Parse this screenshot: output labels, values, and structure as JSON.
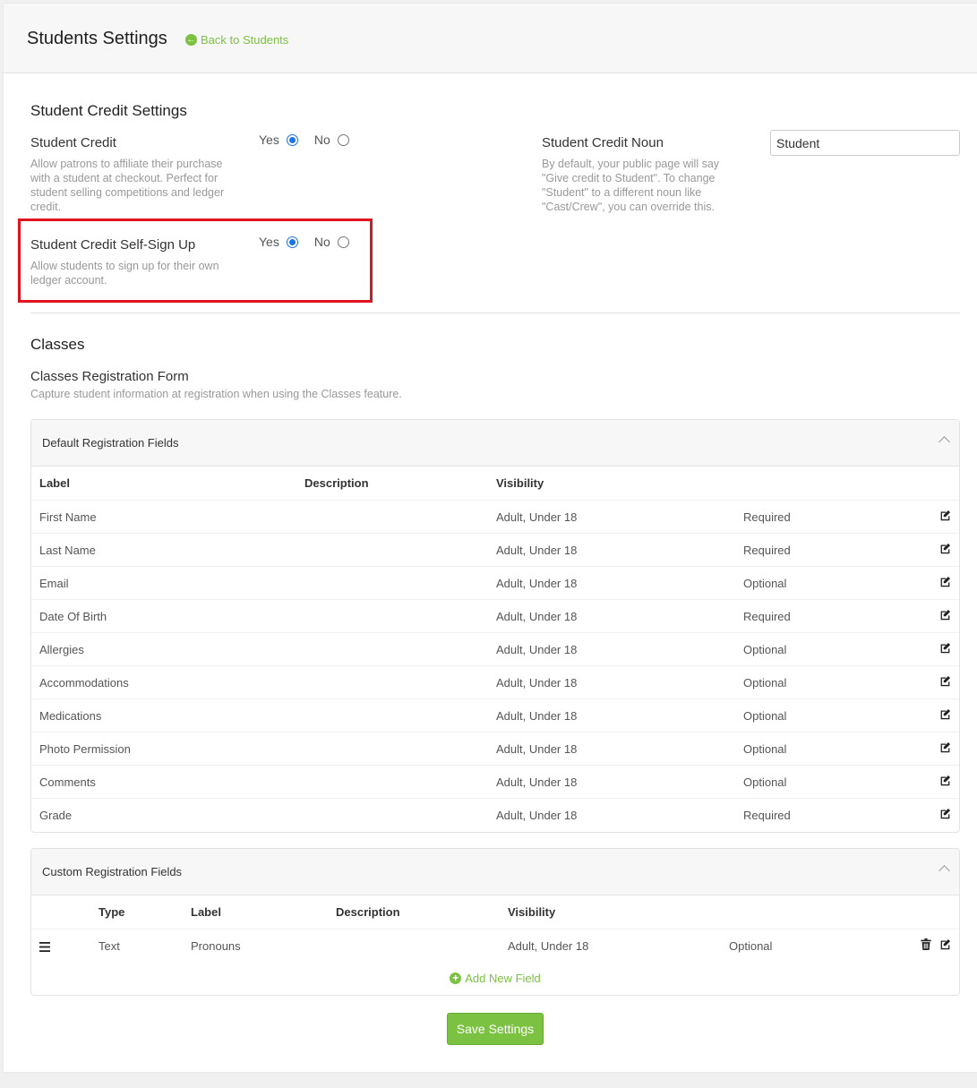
{
  "header": {
    "title": "Students Settings",
    "back_label": "Back to Students"
  },
  "credit": {
    "section_title": "Student Credit Settings",
    "student_credit": {
      "label": "Student Credit",
      "help": "Allow patrons to affiliate their purchase with a student at checkout. Perfect for student selling competitions and ledger credit.",
      "yes": "Yes",
      "no": "No",
      "selected": "Yes"
    },
    "self_signup": {
      "label": "Student Credit Self-Sign Up",
      "help": "Allow students to sign up for their own ledger account.",
      "yes": "Yes",
      "no": "No",
      "selected": "Yes"
    },
    "noun": {
      "label": "Student Credit Noun",
      "help": "By default, your public page will say \"Give credit to Student\". To change \"Student\" to a different noun like \"Cast/Crew\", you can override this.",
      "value": "Student"
    }
  },
  "classes": {
    "section_title": "Classes",
    "form_title": "Classes Registration Form",
    "form_help": "Capture student information at registration when using the Classes feature.",
    "default_panel": {
      "title": "Default Registration Fields",
      "columns": [
        "Label",
        "Description",
        "Visibility"
      ],
      "rows": [
        {
          "label": "First Name",
          "description": "",
          "visibility": "Adult, Under 18",
          "requirement": "Required"
        },
        {
          "label": "Last Name",
          "description": "",
          "visibility": "Adult, Under 18",
          "requirement": "Required"
        },
        {
          "label": "Email",
          "description": "",
          "visibility": "Adult, Under 18",
          "requirement": "Optional"
        },
        {
          "label": "Date Of Birth",
          "description": "",
          "visibility": "Adult, Under 18",
          "requirement": "Required"
        },
        {
          "label": "Allergies",
          "description": "",
          "visibility": "Adult, Under 18",
          "requirement": "Optional"
        },
        {
          "label": "Accommodations",
          "description": "",
          "visibility": "Adult, Under 18",
          "requirement": "Optional"
        },
        {
          "label": "Medications",
          "description": "",
          "visibility": "Adult, Under 18",
          "requirement": "Optional"
        },
        {
          "label": "Photo Permission",
          "description": "",
          "visibility": "Adult, Under 18",
          "requirement": "Optional"
        },
        {
          "label": "Comments",
          "description": "",
          "visibility": "Adult, Under 18",
          "requirement": "Optional"
        },
        {
          "label": "Grade",
          "description": "",
          "visibility": "Adult, Under 18",
          "requirement": "Required"
        }
      ]
    },
    "custom_panel": {
      "title": "Custom Registration Fields",
      "columns": [
        "Type",
        "Label",
        "Description",
        "Visibility"
      ],
      "rows": [
        {
          "type": "Text",
          "label": "Pronouns",
          "description": "",
          "visibility": "Adult, Under 18",
          "requirement": "Optional"
        }
      ],
      "add_label": "Add New Field"
    }
  },
  "save_label": "Save Settings",
  "colors": {
    "accent_green": "#7cc242",
    "highlight_red": "#e0141e",
    "radio_blue": "#1a73e8"
  }
}
